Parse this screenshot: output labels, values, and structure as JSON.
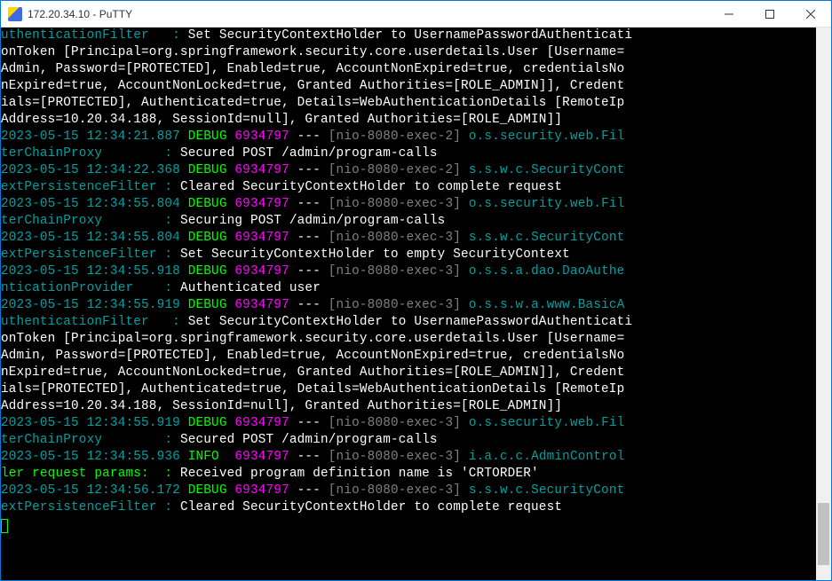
{
  "window": {
    "title": "172.20.34.10 - PuTTY"
  },
  "log": {
    "block1_lines": [
      "uthenticationFilter  : Set SecurityContextHolder to UsernamePasswordAuthenticati",
      "onToken [Principal=org.springframework.security.core.userdetails.User [Username=",
      "Admin, Password=[PROTECTED], Enabled=true, AccountNonExpired=true, credentialsNo",
      "nExpired=true, AccountNonLocked=true, Granted Authorities=[ROLE_ADMIN]], Credent",
      "ials=[PROTECTED], Authenticated=true, Details=WebAuthenticationDetails [RemoteIp",
      "Address=10.20.34.188, SessionId=null], Granted Authorities=[ROLE_ADMIN]]"
    ],
    "entries": [
      {
        "ts": "2023-05-15 12:34:21.887",
        "lvl": "DEBUG",
        "pid": "6934797",
        "thread": "[nio-8080-exec-2]",
        "logger": "o.s.security.web.Fil",
        "cont": "terChainProxy        :",
        "msg": "Secured POST /admin/program-calls"
      },
      {
        "ts": "2023-05-15 12:34:22.368",
        "lvl": "DEBUG",
        "pid": "6934797",
        "thread": "[nio-8080-exec-2]",
        "logger": "s.s.w.c.SecurityCont",
        "cont": "extPersistenceFilter :",
        "msg": "Cleared SecurityContextHolder to complete request"
      },
      {
        "ts": "2023-05-15 12:34:55.804",
        "lvl": "DEBUG",
        "pid": "6934797",
        "thread": "[nio-8080-exec-3]",
        "logger": "o.s.security.web.Fil",
        "cont": "terChainProxy        :",
        "msg": "Securing POST /admin/program-calls"
      },
      {
        "ts": "2023-05-15 12:34:55.804",
        "lvl": "DEBUG",
        "pid": "6934797",
        "thread": "[nio-8080-exec-3]",
        "logger": "s.s.w.c.SecurityCont",
        "cont": "extPersistenceFilter :",
        "msg": "Set SecurityContextHolder to empty SecurityContext"
      },
      {
        "ts": "2023-05-15 12:34:55.918",
        "lvl": "DEBUG",
        "pid": "6934797",
        "thread": "[nio-8080-exec-3]",
        "logger": "o.s.s.a.dao.DaoAuthe",
        "cont": "nticationProvider    :",
        "msg": "Authenticated user"
      },
      {
        "ts": "2023-05-15 12:34:55.919",
        "lvl": "DEBUG",
        "pid": "6934797",
        "thread": "[nio-8080-exec-3]",
        "logger": "o.s.s.w.a.www.BasicA",
        "cont": "",
        "msg": ""
      }
    ],
    "block2_lines": [
      "uthenticationFilter  : Set SecurityContextHolder to UsernamePasswordAuthenticati",
      "onToken [Principal=org.springframework.security.core.userdetails.User [Username=",
      "Admin, Password=[PROTECTED], Enabled=true, AccountNonExpired=true, credentialsNo",
      "nExpired=true, AccountNonLocked=true, Granted Authorities=[ROLE_ADMIN]], Credent",
      "ials=[PROTECTED], Authenticated=true, Details=WebAuthenticationDetails [RemoteIp",
      "Address=10.20.34.188, SessionId=null], Granted Authorities=[ROLE_ADMIN]]"
    ],
    "entries2": [
      {
        "ts": "2023-05-15 12:34:55.919",
        "lvl": "DEBUG",
        "pid": "6934797",
        "thread": "[nio-8080-exec-3]",
        "logger": "o.s.security.web.Fil",
        "cont": "terChainProxy        :",
        "msg": "Secured POST /admin/program-calls"
      },
      {
        "ts": "2023-05-15 12:34:55.936",
        "lvl": "INFO ",
        "pid": "6934797",
        "thread": "[nio-8080-exec-3]",
        "logger": "i.a.c.c.AdminControl",
        "cont": "",
        "msg": ""
      }
    ],
    "ler_line_prefix": "ler request params:  :",
    "ler_line_msg": " Received program definition name is 'CRTORDER'",
    "entries3": [
      {
        "ts": "2023-05-15 12:34:56.172",
        "lvl": "DEBUG",
        "pid": "6934797",
        "thread": "[nio-8080-exec-3]",
        "logger": "s.s.w.c.SecurityCont",
        "cont": "extPersistenceFilter :",
        "msg": "Cleared SecurityContextHolder to complete request"
      }
    ],
    "separator": " --- "
  }
}
